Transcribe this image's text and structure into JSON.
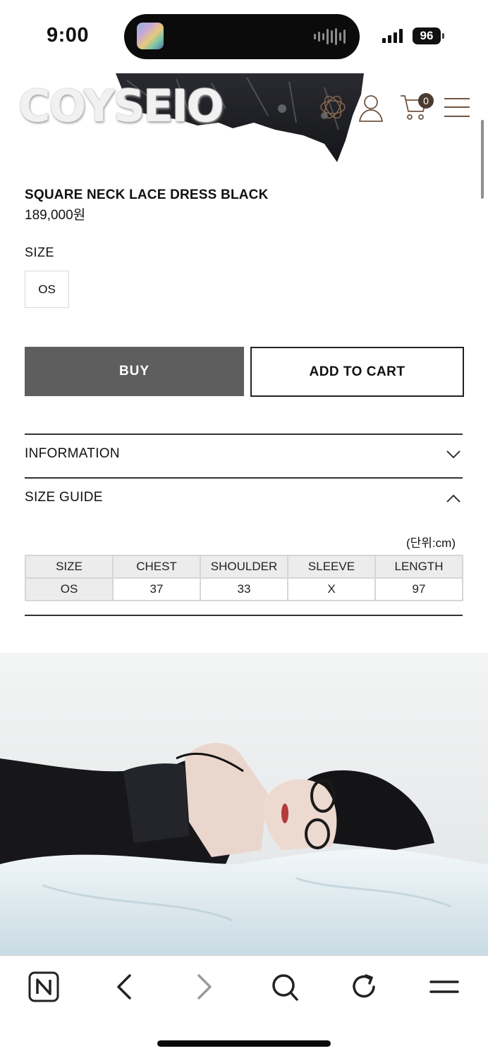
{
  "status_bar": {
    "time": "9:00",
    "battery": "96"
  },
  "header": {
    "logo": "COYSEIO",
    "cart_count": "0"
  },
  "product": {
    "name": "SQUARE NECK LACE DRESS BLACK",
    "price": "189,000원",
    "size_label": "SIZE",
    "size_options": [
      "OS"
    ],
    "buy_label": "BUY",
    "add_to_cart_label": "ADD TO CART"
  },
  "accordion": {
    "information_label": "INFORMATION",
    "size_guide_label": "SIZE GUIDE"
  },
  "size_guide": {
    "unit": "(단위:cm)",
    "headers": [
      "SIZE",
      "CHEST",
      "SHOULDER",
      "SLEEVE",
      "LENGTH"
    ],
    "rows": [
      [
        "OS",
        "37",
        "33",
        "X",
        "97"
      ]
    ]
  },
  "icons": {
    "header": [
      "flower-logo-icon",
      "user-icon",
      "cart-icon",
      "menu-icon"
    ],
    "browser": [
      "naver-home-icon",
      "back-icon",
      "forward-icon",
      "search-icon",
      "refresh-icon",
      "menu-icon"
    ]
  },
  "colors": {
    "buy_button": "#5e5e5e",
    "cart_badge": "#4a3b30"
  }
}
